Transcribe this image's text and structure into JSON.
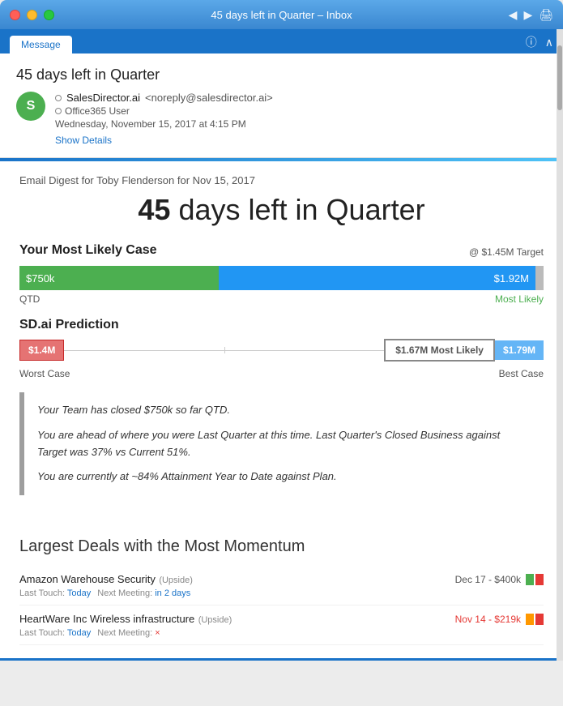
{
  "titlebar": {
    "title": "45 days left in Quarter – Inbox",
    "back_icon": "◀",
    "forward_icon": "▶",
    "print_icon": "🖨",
    "help_icon": "?",
    "expand_icon": "∧"
  },
  "tabs": {
    "active_tab": "Message",
    "help": "?",
    "expand": "∧"
  },
  "email": {
    "subject": "45 days left in Quarter",
    "avatar_letter": "S",
    "sender_name": "SalesDirector.ai",
    "sender_email": "<noreply@salesdirector.ai>",
    "sender_org": "Office365 User",
    "date": "Wednesday, November 15, 2017 at 4:15 PM",
    "show_details": "Show Details"
  },
  "body": {
    "digest_label": "Email Digest for Toby Flenderson for Nov 15, 2017",
    "headline_number": "45",
    "headline_rest": " days left in Quarter",
    "most_likely_title": "Your Most Likely Case",
    "target_label": "@ $1.45M Target",
    "progress_green_label": "$750k",
    "progress_blue_label": "$1.92M",
    "qtd_label": "QTD",
    "most_likely_sublabel": "Most Likely",
    "prediction_title": "SD.ai Prediction",
    "pred_worst": "$1.4M",
    "pred_most_likely": "$1.67M Most Likely",
    "pred_best": "$1.79M",
    "pred_worst_case": "Worst Case",
    "pred_best_case": "Best Case",
    "text1": "Your Team has closed $750k so far QTD.",
    "text2": "You are ahead of where you were Last Quarter at this time. Last Quarter's Closed Business against Target was 37% vs Current 51%.",
    "text3": "You are currently at ~84% Attainment Year to Date against Plan.",
    "deals_title": "Largest Deals with the Most Momentum",
    "deals": [
      {
        "name": "Amazon Warehouse Security",
        "tag": "(Upside)",
        "date_amount": "Dec 17 - $400k",
        "date_color": "neutral",
        "last_touch": "Today",
        "next_meeting": "in 2 days",
        "bars": [
          "green",
          "red"
        ]
      },
      {
        "name": "HeartWare Inc Wireless infrastructure",
        "tag": "(Upside)",
        "date_amount": "Nov 14 - $219k",
        "date_color": "red",
        "last_touch": "Today",
        "next_meeting": "×",
        "bars": [
          "orange",
          "red"
        ]
      }
    ]
  }
}
